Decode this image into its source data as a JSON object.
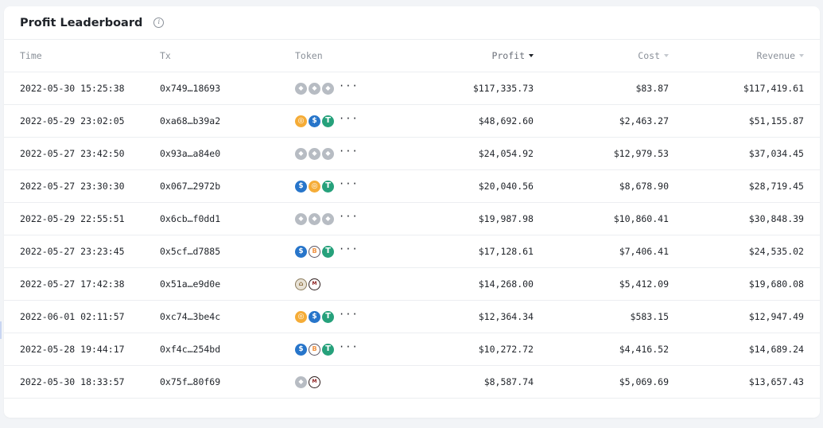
{
  "card": {
    "title": "Profit Leaderboard",
    "info_icon": "info-icon"
  },
  "columns": {
    "time": "Time",
    "tx": "Tx",
    "token": "Token",
    "profit": "Profit",
    "cost": "Cost",
    "revenue": "Revenue"
  },
  "more_label": "···",
  "rows": [
    {
      "time": "2022-05-30 15:25:38",
      "tx": "0x749…18693",
      "tokens": [
        "eth",
        "eth",
        "eth"
      ],
      "more": true,
      "profit": "$117,335.73",
      "cost": "$83.87",
      "revenue": "$117,419.61"
    },
    {
      "time": "2022-05-29 23:02:05",
      "tx": "0xa68…b39a2",
      "tokens": [
        "dai",
        "usdc",
        "usdt"
      ],
      "more": true,
      "profit": "$48,692.60",
      "cost": "$2,463.27",
      "revenue": "$51,155.87"
    },
    {
      "time": "2022-05-27 23:42:50",
      "tx": "0x93a…a84e0",
      "tokens": [
        "eth",
        "eth",
        "eth"
      ],
      "more": true,
      "profit": "$24,054.92",
      "cost": "$12,979.53",
      "revenue": "$37,034.45"
    },
    {
      "time": "2022-05-27 23:30:30",
      "tx": "0x067…2972b",
      "tokens": [
        "usdc",
        "dai",
        "usdt"
      ],
      "more": true,
      "profit": "$20,040.56",
      "cost": "$8,678.90",
      "revenue": "$28,719.45"
    },
    {
      "time": "2022-05-29 22:55:51",
      "tx": "0x6cb…f0dd1",
      "tokens": [
        "eth",
        "eth",
        "eth"
      ],
      "more": true,
      "profit": "$19,987.98",
      "cost": "$10,860.41",
      "revenue": "$30,848.39"
    },
    {
      "time": "2022-05-27 23:23:45",
      "tx": "0x5cf…d7885",
      "tokens": [
        "usdc",
        "wbtc",
        "usdt"
      ],
      "more": true,
      "profit": "$17,128.61",
      "cost": "$7,406.41",
      "revenue": "$24,535.02"
    },
    {
      "time": "2022-05-27 17:42:38",
      "tx": "0x51a…e9d0e",
      "tokens": [
        "ens",
        "meta"
      ],
      "more": false,
      "profit": "$14,268.00",
      "cost": "$5,412.09",
      "revenue": "$19,680.08"
    },
    {
      "time": "2022-06-01 02:11:57",
      "tx": "0xc74…3be4c",
      "tokens": [
        "dai",
        "usdc",
        "usdt"
      ],
      "more": true,
      "profit": "$12,364.34",
      "cost": "$583.15",
      "revenue": "$12,947.49"
    },
    {
      "time": "2022-05-28 19:44:17",
      "tx": "0xf4c…254bd",
      "tokens": [
        "usdc",
        "wbtc",
        "usdt"
      ],
      "more": true,
      "profit": "$10,272.72",
      "cost": "$4,416.52",
      "revenue": "$14,689.24"
    },
    {
      "time": "2022-05-30 18:33:57",
      "tx": "0x75f…80f69",
      "tokens": [
        "eth",
        "meta"
      ],
      "more": false,
      "profit": "$8,587.74",
      "cost": "$5,069.69",
      "revenue": "$13,657.43"
    }
  ]
}
